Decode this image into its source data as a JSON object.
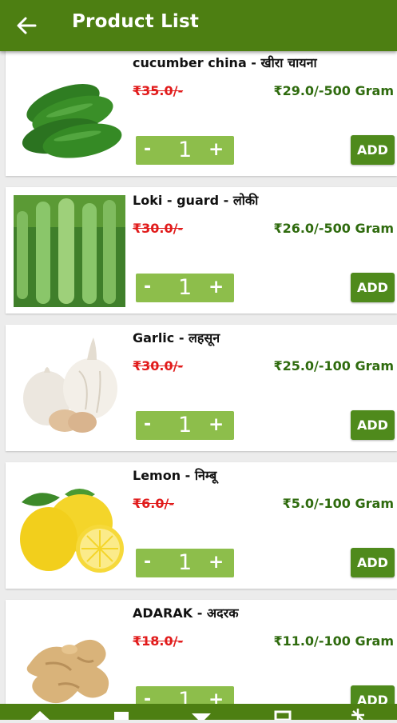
{
  "appbar": {
    "title": "Product List",
    "back_icon": "arrow-left-icon"
  },
  "colors": {
    "primary": "#4d7f12",
    "strike": "#e11b1b",
    "price": "#2f6b0e",
    "stepper": "#8dbe4b"
  },
  "products": [
    {
      "name": "cucumber china - खीरा  चायना",
      "mrp": "₹35.0/-",
      "price": "₹29.0/-500 Gram",
      "qty": "1",
      "add_label": "ADD",
      "image": "cucumber"
    },
    {
      "name": "Loki - guard - लोकी",
      "mrp": "₹30.0/-",
      "price": "₹26.0/-500 Gram",
      "qty": "1",
      "add_label": "ADD",
      "image": "bottle-gourd"
    },
    {
      "name": "Garlic - लहसून",
      "mrp": "₹30.0/-",
      "price": "₹25.0/-100 Gram",
      "qty": "1",
      "add_label": "ADD",
      "image": "garlic"
    },
    {
      "name": "Lemon - निम्बू",
      "mrp": "₹6.0/-",
      "price": "₹5.0/-100 Gram",
      "qty": "1",
      "add_label": "ADD",
      "image": "lemon"
    },
    {
      "name": "ADARAK - अदरक",
      "mrp": "₹18.0/-",
      "price": "₹11.0/-100 Gram",
      "qty": "1",
      "add_label": "ADD",
      "image": "ginger"
    }
  ],
  "stepper": {
    "minus": "-",
    "plus": "+"
  },
  "bottom_nav": {
    "icons": [
      "home-icon",
      "plus-box-icon",
      "filter-icon",
      "list-icon",
      "settings-icon"
    ]
  }
}
